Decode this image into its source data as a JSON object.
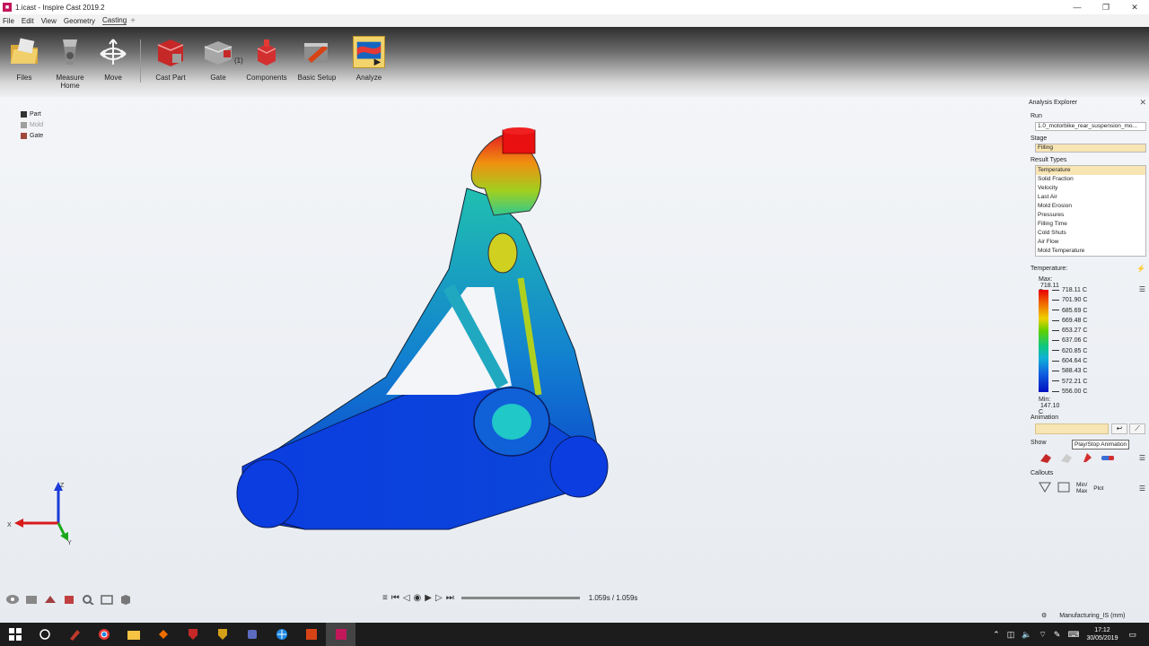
{
  "window": {
    "title": "1.icast - Inspire Cast 2019.2"
  },
  "menu": [
    {
      "label": "File"
    },
    {
      "label": "Edit"
    },
    {
      "label": "View"
    },
    {
      "label": "Geometry"
    },
    {
      "label": "Casting",
      "active": true
    }
  ],
  "ribbon": {
    "files": "Files",
    "measure": "Measure",
    "home": "Home",
    "move": "Move",
    "cast_part": "Cast Part",
    "gate": "Gate",
    "gate_badge": "(1)",
    "components": "Components",
    "basic_setup": "Basic Setup",
    "analyze": "Analyze"
  },
  "legend": [
    {
      "label": "Part",
      "color": "#333333"
    },
    {
      "label": "Mold",
      "color": "#9e9e9e"
    },
    {
      "label": "Gate",
      "color": "#a0473c"
    }
  ],
  "playback": {
    "time": "1.059s / 1.059s"
  },
  "explorer": {
    "title": "Analysis Explorer",
    "run_label": "Run",
    "run_value": "1.0_motorbike_rear_suspension_mo...",
    "stage_label": "Stage",
    "stage_value": "Filling",
    "result_types_label": "Result Types",
    "result_types": [
      "Temperature",
      "Solid Fraction",
      "Velocity",
      "Last Air",
      "Mold Erosion",
      "Pressures",
      "Filling Time",
      "Cold Shuts",
      "Air Flow",
      "Mold Temperature"
    ],
    "temperature_label": "Temperature:",
    "max_label": "Max:",
    "max_value": "718.11 C",
    "min_label": "Min:",
    "min_value": "147.10 C",
    "scale_values": [
      "718.11 C",
      "701.90 C",
      "685.69 C",
      "669.48 C",
      "653.27 C",
      "637.06 C",
      "620.85 C",
      "604.64 C",
      "588.43 C",
      "572.21 C",
      "556.00 C"
    ],
    "animation_label": "Animation",
    "tooltip": "Play/Stop Animation",
    "show_label": "Show",
    "callouts_label": "Callouts",
    "minmax_top": "Min/",
    "minmax_bottom": "Max",
    "plot_label": "Plot"
  },
  "status": {
    "units": "Manufacturing_IS (mm)"
  },
  "taskbar": {
    "time": "17:12",
    "date": "30/05/2019"
  }
}
